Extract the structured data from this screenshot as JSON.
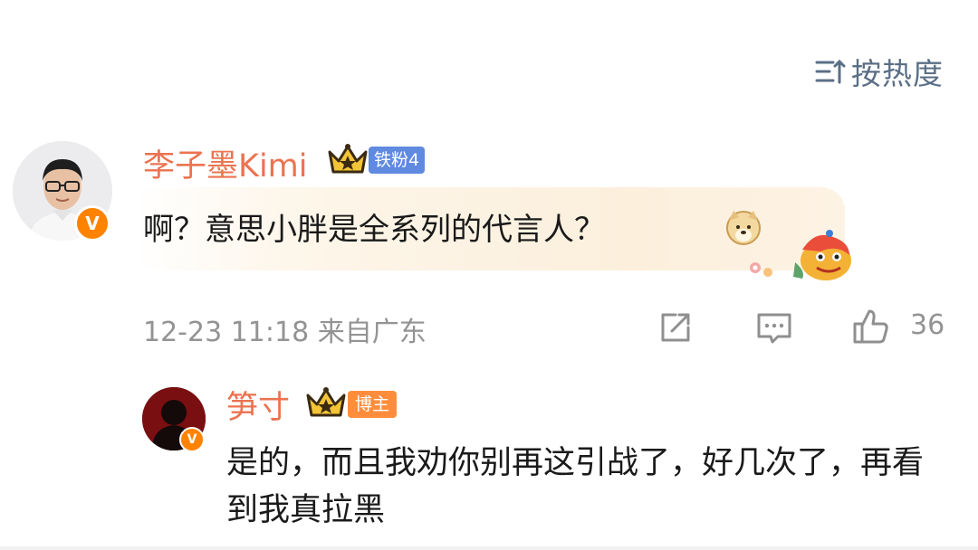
{
  "sort": {
    "label": "按热度",
    "icon": "sort-icon"
  },
  "comment": {
    "author": "李子墨Kimi",
    "fan_badge": "铁粉4",
    "text": "啊？意思小胖是全系列的代言人？",
    "time": "12-23 11:18",
    "location": "来自广东",
    "likes": "36",
    "icons": [
      "crown-icon",
      "verified-icon",
      "doge-emoji-icon",
      "lion-dance-decoration-icon",
      "share-icon",
      "comment-icon",
      "like-icon"
    ]
  },
  "reply": {
    "author": "笋寸",
    "role_badge": "博主",
    "text": "是的，而且我劝你别再这引战了，好几次了，再看到我真拉黑",
    "icons": [
      "crown-icon",
      "verified-icon"
    ]
  },
  "colors": {
    "name": "#eb7350",
    "meta": "#939393",
    "sort": "#5b6f86",
    "fan_badge": "#5f8ae0",
    "blogger_badge": "#ff8d3c",
    "verified": "#ff8200"
  }
}
